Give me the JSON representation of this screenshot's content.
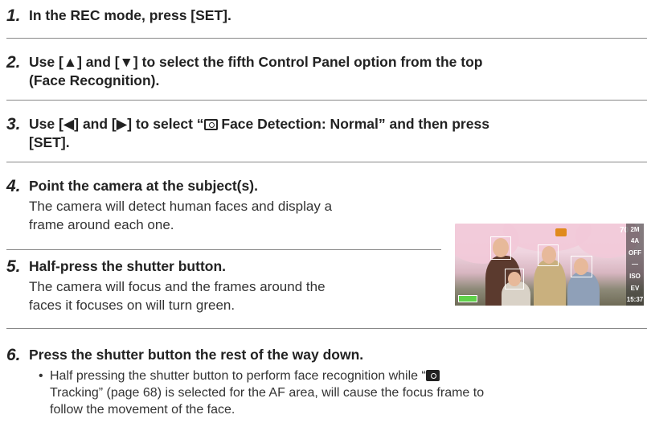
{
  "steps": [
    {
      "num": "1.",
      "title": "In the REC mode, press [SET]."
    },
    {
      "num": "2.",
      "title_line1": "Use [▲] and [▼] to select the fifth Control Panel option from the top",
      "title_line2": "(Face Recognition)."
    },
    {
      "num": "3.",
      "title_a": "Use [◀] and [▶] to select “",
      "title_b": " Face Detection: Normal” and then press",
      "title_line2": "[SET]."
    },
    {
      "num": "4.",
      "title": "Point the camera at the subject(s).",
      "body_line1": "The camera will detect human faces and display a",
      "body_line2": "frame around each one."
    },
    {
      "num": "5.",
      "title": "Half-press the shutter button.",
      "body_line1": "The camera will focus and the frames around the",
      "body_line2": "faces it focuses on will turn green."
    },
    {
      "num": "6.",
      "title": "Press the shutter button the rest of the way down.",
      "bullet": "•",
      "bullet_a": "Half pressing the shutter button to perform face recognition while “",
      "bullet_b": "",
      "bullet_line2": "Tracking” (page 68) is selected for the AF area, will cause the focus frame to",
      "bullet_line3": "follow the movement of the face."
    }
  ],
  "photo": {
    "shot_count": "70",
    "time": "15:37",
    "side_indicators": [
      "2M",
      "4A",
      "OFF",
      "—",
      "",
      "ISO",
      "EV",
      "15:37"
    ],
    "colors": {
      "face_frame": "#ffffff",
      "camera_icon": "#e08a1c",
      "battery": "#5fd14a"
    }
  }
}
